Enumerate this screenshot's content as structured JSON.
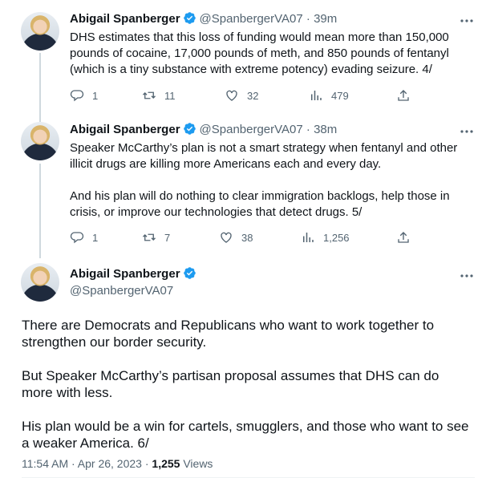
{
  "tweets": [
    {
      "name": "Abigail Spanberger",
      "handle": "@SpanbergerVA07",
      "time": "· 39m",
      "text": "DHS estimates that this loss of funding would mean more than 150,000 pounds of cocaine, 17,000 pounds of meth, and 850 pounds of fentanyl (which is a tiny substance with extreme potency) evading seizure. 4/",
      "replies": "1",
      "retweets": "11",
      "likes": "32",
      "views": "479"
    },
    {
      "name": "Abigail Spanberger",
      "handle": "@SpanbergerVA07",
      "time": "· 38m",
      "text": "Speaker McCarthy’s plan is not a smart strategy when fentanyl and other illicit drugs are killing more Americans each and every day.\n\nAnd his plan will do nothing to clear immigration backlogs, help those in crisis, or improve our technologies that detect drugs. 5/",
      "replies": "1",
      "retweets": "7",
      "likes": "38",
      "views": "1,256"
    }
  ],
  "main_tweet": {
    "name": "Abigail Spanberger",
    "handle": "@SpanbergerVA07",
    "text": "There are Democrats and Republicans who want to work together to strengthen our border security.\n\nBut Speaker McCarthy’s partisan proposal assumes that DHS can do more with less.\n\nHis plan would be a win for cartels, smugglers, and those who want to see a weaker America. 6/",
    "timestamp": "11:54 AM · Apr 26, 2023 · ",
    "views_count": "1,255",
    "views_label": " Views"
  },
  "colors": {
    "verified": "#1d9bf0",
    "text": "#0f1419",
    "secondary": "#536471"
  }
}
